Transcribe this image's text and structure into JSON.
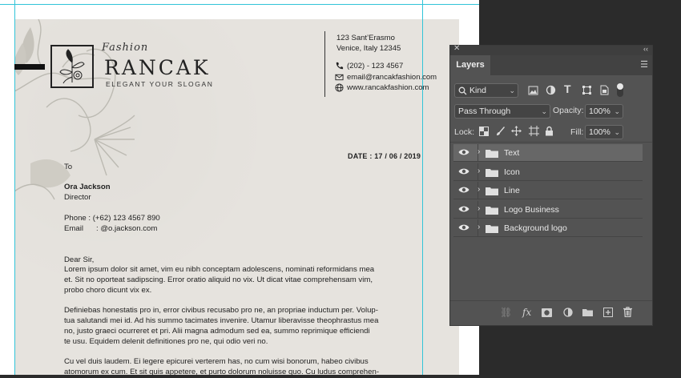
{
  "document": {
    "logo": {
      "script": "Fashion",
      "name": "RANCAK",
      "slogan": "ELEGANT YOUR SLOGAN"
    },
    "address": [
      "123 Sant’Erasmo",
      "Venice, Italy 12345"
    ],
    "contacts": [
      {
        "icon": "phone-icon",
        "text": "(202) - 123 4567"
      },
      {
        "icon": "email-icon",
        "text": "email@rancakfashion.com"
      },
      {
        "icon": "globe-icon",
        "text": "www.rancakfashion.com"
      }
    ],
    "date": "DATE : 17 / 06 / 2019",
    "to_label": "To",
    "recipient_name": "Ora Jackson",
    "recipient_title": "Director",
    "phone_line": "Phone : (+62) 123 4567 890",
    "email_line": "Email      : @o.jackson.com",
    "salutation": "Dear Sir,",
    "paragraph1": [
      "Lorem ipsum dolor sit amet, vim eu nibh conceptam adolescens, nominati reformidans mea",
      "et. Sit no oporteat sadipscing. Error oratio aliquid no vix. Ut dicat vitae comprehensam vim,",
      "probo choro dicunt vix ex."
    ],
    "paragraph2": [
      "Definiebas honestatis pro in, error civibus recusabo pro ne, an propriae inductum per. Volup-",
      "tua salutandi mei id. Ad his summo tacimates invenire. Utamur liberavisse theophrastus mea",
      "no, justo graeci ocurreret et pri. Alii magna admodum sed ea, summo reprimique efficiendi",
      "te usu. Equidem delenit definitiones pro ne, qui odio veri no."
    ],
    "paragraph3": [
      "Cu vel duis laudem. Ei legere epicurei verterem has, no cum wisi bonorum, habeo civibus",
      "atomorum ex cum. Et sit quis appetere, et purto dolorum noluisse quo. Cu ludus comprehen-"
    ]
  },
  "layers_panel": {
    "title": "Layers",
    "filter_kind": "Kind",
    "blend_mode": "Pass Through",
    "opacity_label": "Opacity:",
    "opacity_value": "100%",
    "lock_label": "Lock:",
    "fill_label": "Fill:",
    "fill_value": "100%",
    "layers": [
      {
        "name": "Text",
        "selected": true
      },
      {
        "name": "Icon",
        "selected": false
      },
      {
        "name": "Line",
        "selected": false
      },
      {
        "name": "Logo Business",
        "selected": false
      },
      {
        "name": "Background logo",
        "selected": false
      }
    ]
  },
  "colors": {
    "panel_bg": "#535353",
    "canvas_bg": "#2b2b2b",
    "paper": "#e6e3de",
    "guide": "#31c4d8"
  }
}
